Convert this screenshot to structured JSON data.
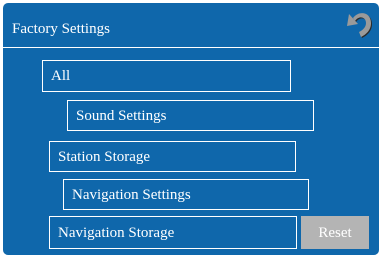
{
  "header": {
    "title": "Factory Settings",
    "back_icon": "undo-arrow-icon"
  },
  "options": {
    "all": "All",
    "sound_settings": "Sound Settings",
    "station_storage": "Station Storage",
    "navigation_settings": "Navigation Settings",
    "navigation_storage": "Navigation Storage"
  },
  "actions": {
    "reset_label": "Reset"
  },
  "colors": {
    "background": "#0f67ab",
    "border": "#ffffff",
    "reset_button": "#b4b4b4"
  }
}
